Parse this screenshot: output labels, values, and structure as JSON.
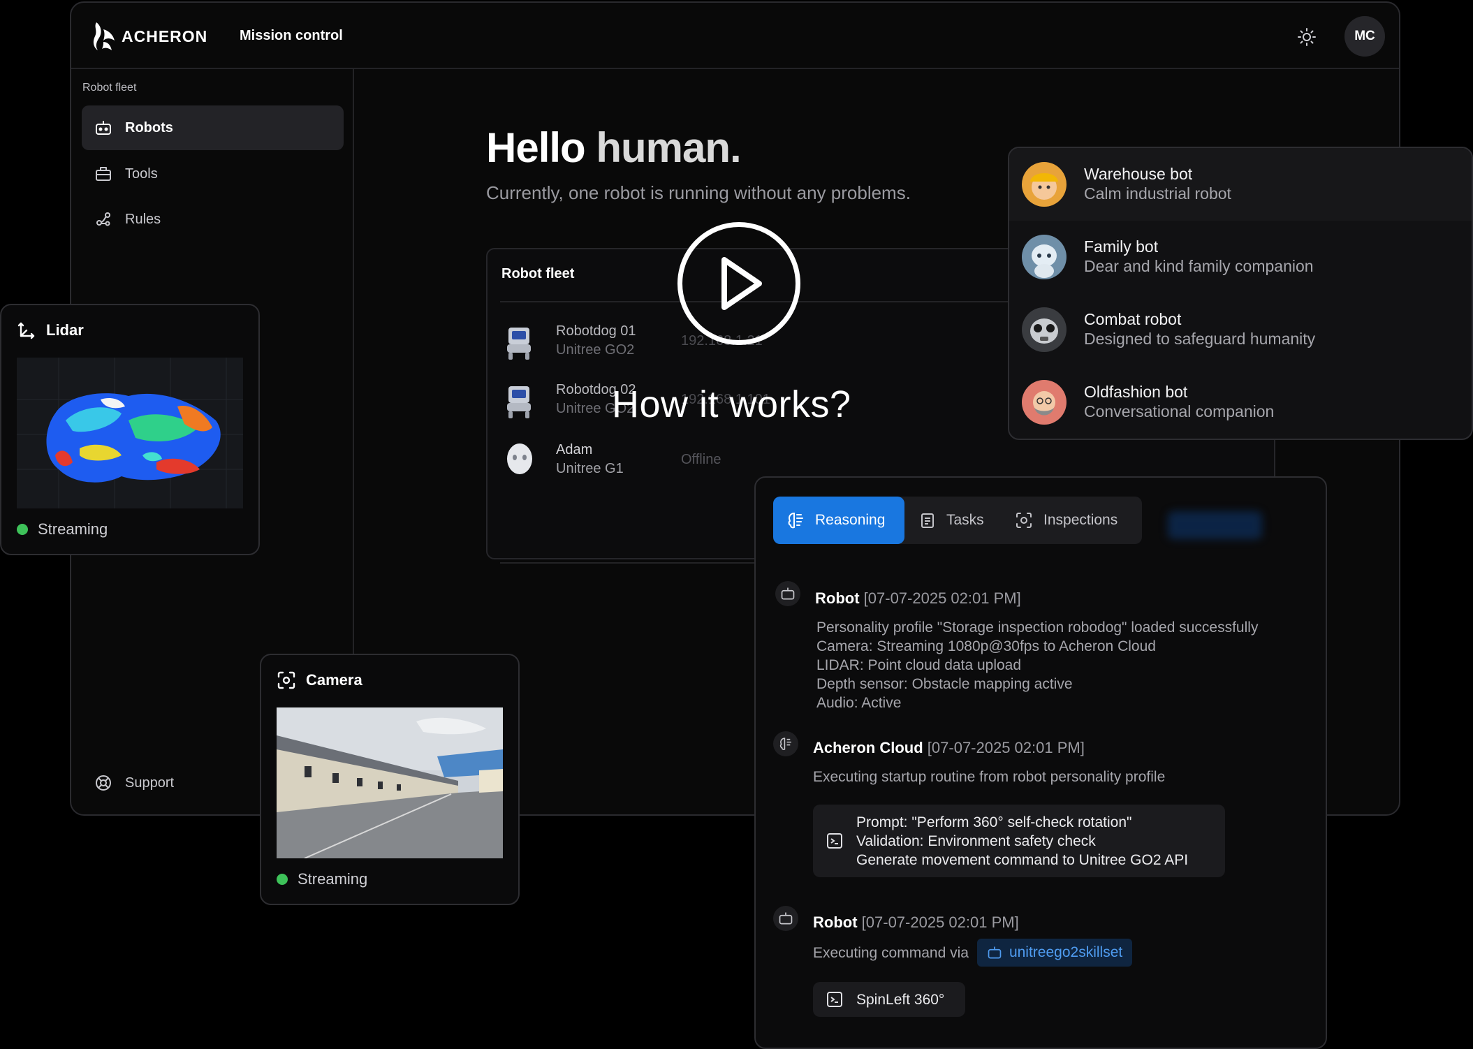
{
  "header": {
    "logo_text": "ACHERON",
    "app_title": "Mission control",
    "avatar_initials": "MC"
  },
  "sidebar": {
    "section_label": "Robot fleet",
    "items": [
      {
        "label": "Robots",
        "icon": "robot-icon",
        "active": true
      },
      {
        "label": "Tools",
        "icon": "toolbox-icon",
        "active": false
      },
      {
        "label": "Rules",
        "icon": "flow-icon",
        "active": false
      }
    ],
    "support_label": "Support"
  },
  "main": {
    "greeting_bold": "Hello",
    "greeting_rest": "human.",
    "subtitle": "Currently, one robot is running without any problems.",
    "fleet": {
      "title": "Robot fleet",
      "robots": [
        {
          "name": "Robotdog 01",
          "model": "Unitree GO2",
          "status": "192.168.1.21"
        },
        {
          "name": "Robotdog 02",
          "model": "Unitree GO2",
          "status": "192.168.1.101"
        },
        {
          "name": "Adam",
          "model": "Unitree G1",
          "status": "Offline"
        }
      ]
    }
  },
  "lidar": {
    "title": "Lidar",
    "status": "Streaming"
  },
  "camera": {
    "title": "Camera",
    "status": "Streaming"
  },
  "bots": [
    {
      "name": "Warehouse bot",
      "description": "Calm industrial robot"
    },
    {
      "name": "Family bot",
      "description": "Dear and kind family companion"
    },
    {
      "name": "Combat robot",
      "description": "Designed to safeguard humanity"
    },
    {
      "name": "Oldfashion bot",
      "description": "Conversational companion"
    }
  ],
  "reasoning": {
    "tabs": [
      {
        "label": "Reasoning",
        "active": true
      },
      {
        "label": "Tasks",
        "active": false
      },
      {
        "label": "Inspections",
        "active": false
      }
    ],
    "log": [
      {
        "author": "Robot",
        "timestamp": "[07-07-2025 02:01 PM]",
        "lines": "Personality profile \"Storage inspection robodog\" loaded successfully\nCamera: Streaming 1080p@30fps to Acheron Cloud\nLIDAR: Point cloud data upload\nDepth sensor: Obstacle mapping active\nAudio: Active"
      },
      {
        "author": "Acheron Cloud",
        "timestamp": "[07-07-2025 02:01 PM]",
        "lines": "Executing startup routine from robot personality profile",
        "code": "Prompt: \"Perform 360° self-check rotation\"\nValidation: Environment safety check\nGenerate movement command to Unitree GO2 API"
      },
      {
        "author": "Robot",
        "timestamp": "[07-07-2025 02:01 PM]",
        "lines": "Executing command via",
        "skill": "unitreego2skillset",
        "code": "SpinLeft 360°"
      }
    ]
  },
  "overlay": {
    "caption": "How it works?"
  },
  "colors": {
    "accent": "#1977e0",
    "streaming": "#3ec25a",
    "background": "#000000"
  }
}
